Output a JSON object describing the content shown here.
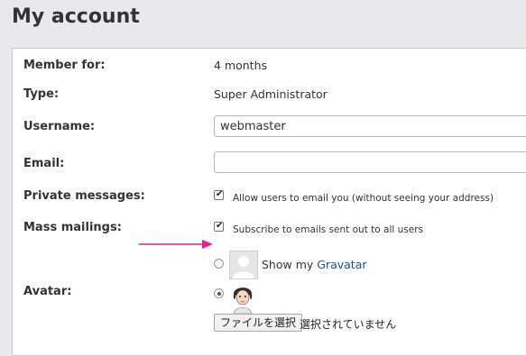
{
  "page": {
    "title": "My account"
  },
  "account": {
    "member_for_label": "Member for:",
    "member_for_value": "4 months",
    "type_label": "Type:",
    "type_value": "Super Administrator",
    "username_label": "Username:",
    "username_value": "webmaster",
    "email_label": "Email:",
    "email_value": "",
    "private_messages_label": "Private messages:",
    "private_messages_option": "Allow users to email you (without seeing your address)",
    "private_messages_checked": true,
    "mass_mailings_label": "Mass mailings:",
    "mass_mailings_option": "Subscribe to emails sent out to all users",
    "mass_mailings_checked": true,
    "avatar_label": "Avatar:",
    "gravatar_prefix": "Show my",
    "gravatar_link": "Gravatar",
    "avatar_selected": "custom"
  },
  "file_upload": {
    "button_label": "ファイルを選択",
    "status": "選択されていません"
  },
  "colors": {
    "arrow": "#ee1b92",
    "link": "#1f4f8b"
  }
}
